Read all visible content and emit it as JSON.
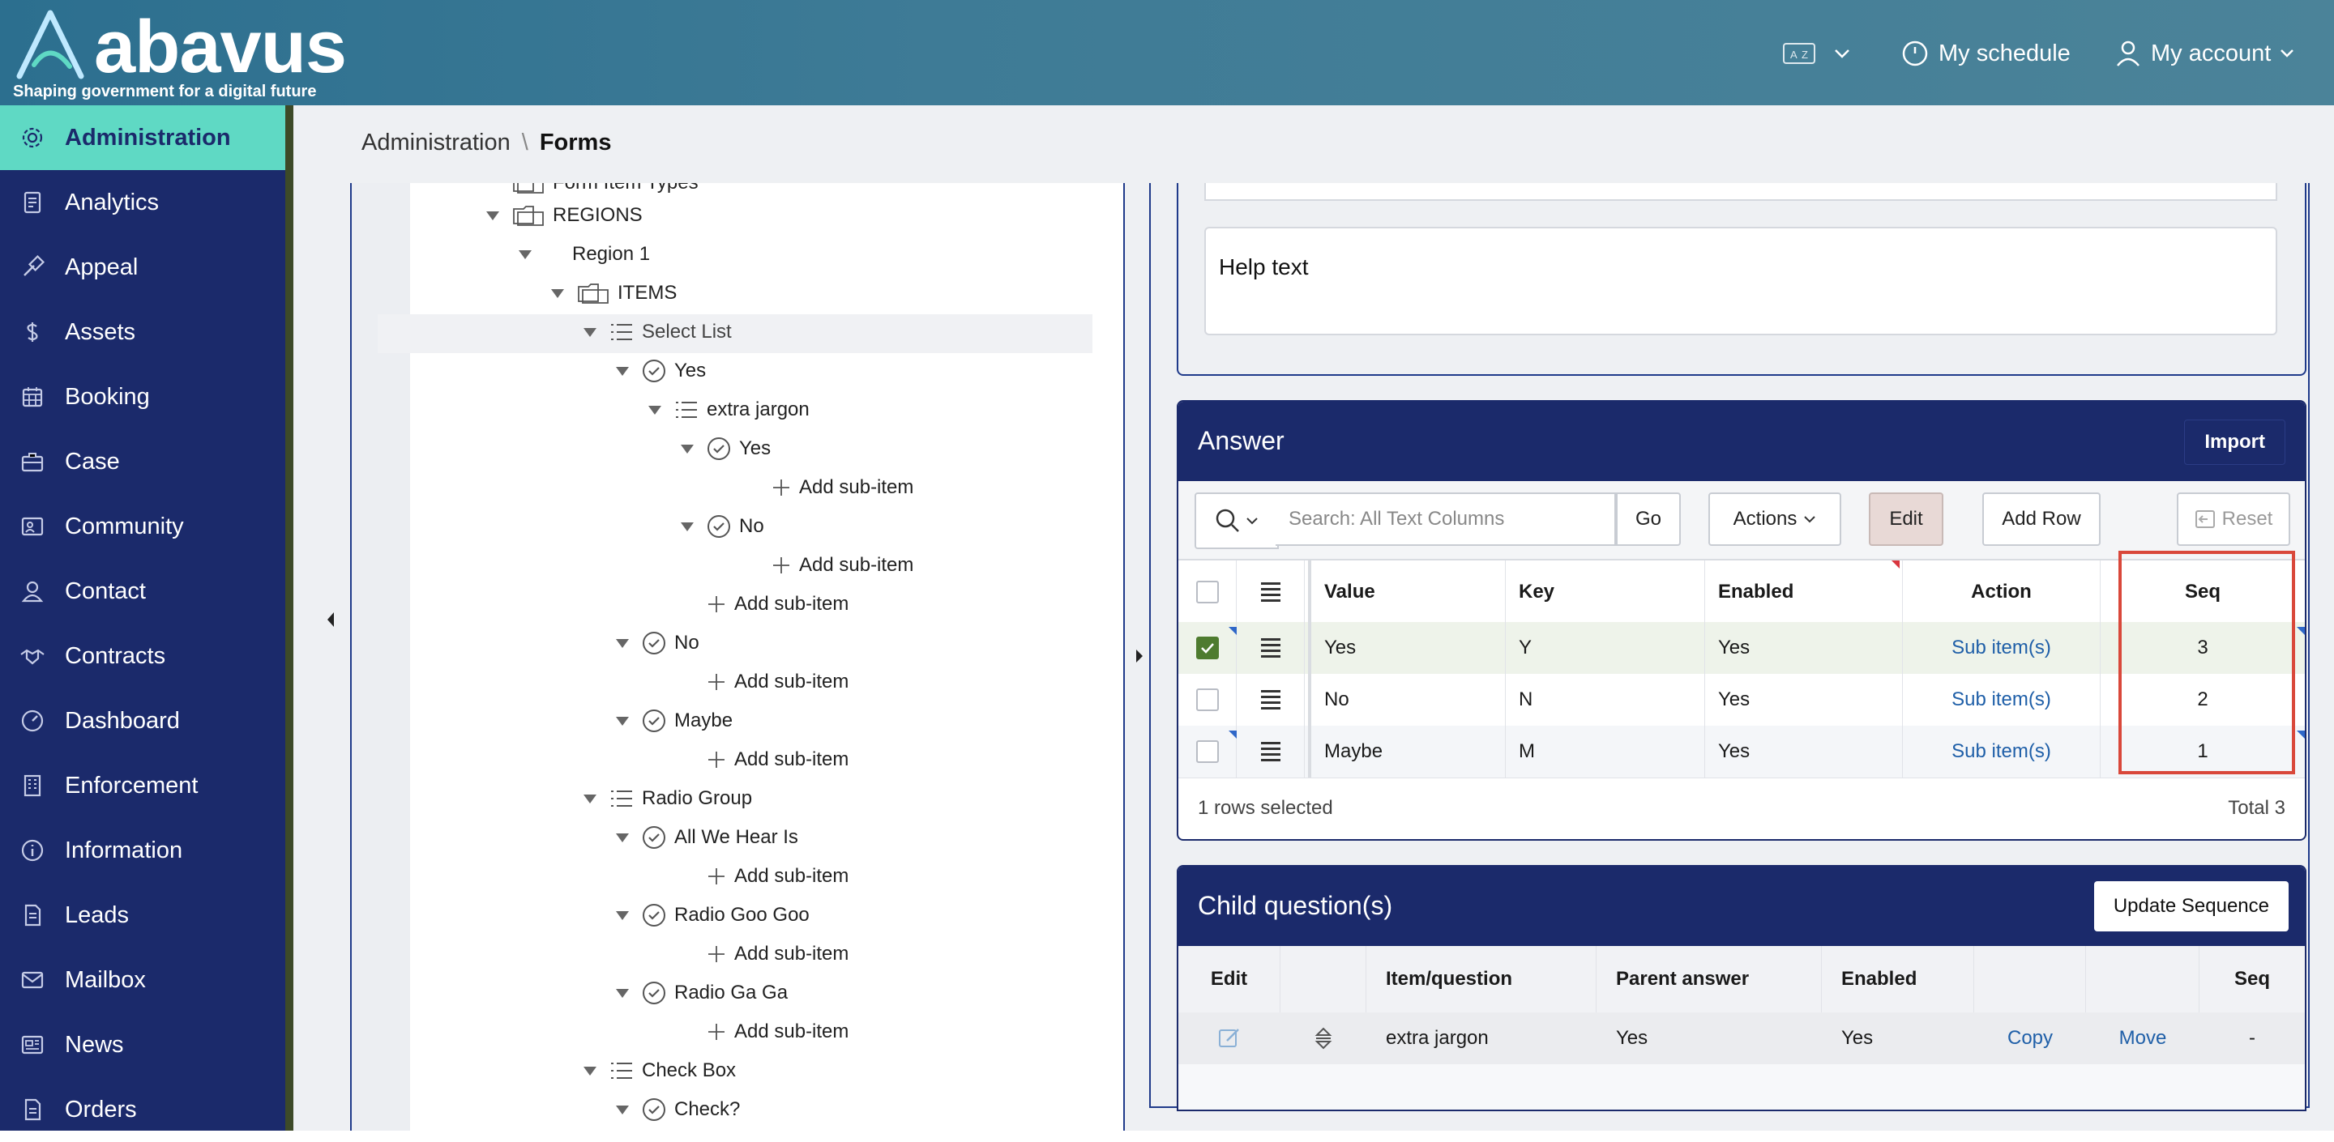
{
  "header": {
    "logo_text": "abavus",
    "logo_tagline": "Shaping government for a digital future",
    "schedule_label": "My schedule",
    "account_label": "My account"
  },
  "sidebar": {
    "items": [
      {
        "label": "Administration",
        "icon": "gear-icon",
        "active": true
      },
      {
        "label": "Analytics",
        "icon": "report-icon"
      },
      {
        "label": "Appeal",
        "icon": "gavel-icon"
      },
      {
        "label": "Assets",
        "icon": "dollar-icon"
      },
      {
        "label": "Booking",
        "icon": "calendar-icon"
      },
      {
        "label": "Case",
        "icon": "briefcase-icon"
      },
      {
        "label": "Community",
        "icon": "community-icon"
      },
      {
        "label": "Contact",
        "icon": "contact-icon"
      },
      {
        "label": "Contracts",
        "icon": "handshake-icon"
      },
      {
        "label": "Dashboard",
        "icon": "dashboard-icon"
      },
      {
        "label": "Enforcement",
        "icon": "building-icon"
      },
      {
        "label": "Information",
        "icon": "info-icon"
      },
      {
        "label": "Leads",
        "icon": "document-icon"
      },
      {
        "label": "Mailbox",
        "icon": "mail-icon"
      },
      {
        "label": "News",
        "icon": "newspaper-icon"
      },
      {
        "label": "Orders",
        "icon": "order-icon"
      }
    ]
  },
  "breadcrumb": {
    "parent": "Administration",
    "separator": "\\",
    "current": "Forms"
  },
  "tree": {
    "partial_top": "Form Item Types",
    "regions": "REGIONS",
    "region1": "Region 1",
    "items": "ITEMS",
    "select_list": "Select List",
    "yes": "Yes",
    "extra_jargon": "extra jargon",
    "sub_yes": "Yes",
    "sub_no": "No",
    "no": "No",
    "maybe": "Maybe",
    "radio_group": "Radio Group",
    "radio1": "All We Hear Is",
    "radio2": "Radio Goo Goo",
    "radio3": "Radio Ga Ga",
    "check_box": "Check Box",
    "check": "Check?",
    "add_sub_item": "Add sub-item"
  },
  "help_text": {
    "value": "Help text"
  },
  "answer": {
    "title": "Answer",
    "import_label": "Import",
    "search_placeholder": "Search: All Text Columns",
    "go_label": "Go",
    "actions_label": "Actions",
    "edit_label": "Edit",
    "add_row_label": "Add Row",
    "reset_label": "Reset",
    "columns": {
      "value": "Value",
      "key": "Key",
      "enabled": "Enabled",
      "action": "Action",
      "seq": "Seq"
    },
    "rows": [
      {
        "value": "Yes",
        "key": "Y",
        "enabled": "Yes",
        "action": "Sub item(s)",
        "seq": "3",
        "selected": true
      },
      {
        "value": "No",
        "key": "N",
        "enabled": "Yes",
        "action": "Sub item(s)",
        "seq": "2",
        "selected": false
      },
      {
        "value": "Maybe",
        "key": "M",
        "enabled": "Yes",
        "action": "Sub item(s)",
        "seq": "1",
        "selected": false
      }
    ],
    "footer_selected": "1 rows selected",
    "footer_total": "Total 3"
  },
  "child": {
    "title": "Child question(s)",
    "update_label": "Update Sequence",
    "columns": {
      "edit": "Edit",
      "item": "Item/question",
      "parent": "Parent answer",
      "enabled": "Enabled",
      "seq": "Seq"
    },
    "row": {
      "item": "extra jargon",
      "parent": "Yes",
      "enabled": "Yes",
      "copy": "Copy",
      "move": "Move",
      "seq": "-"
    }
  },
  "colors": {
    "sidebar": "#1b2a6b",
    "active": "#5fd9c4",
    "header": "#3e7b96",
    "highlight": "#d9483b"
  }
}
